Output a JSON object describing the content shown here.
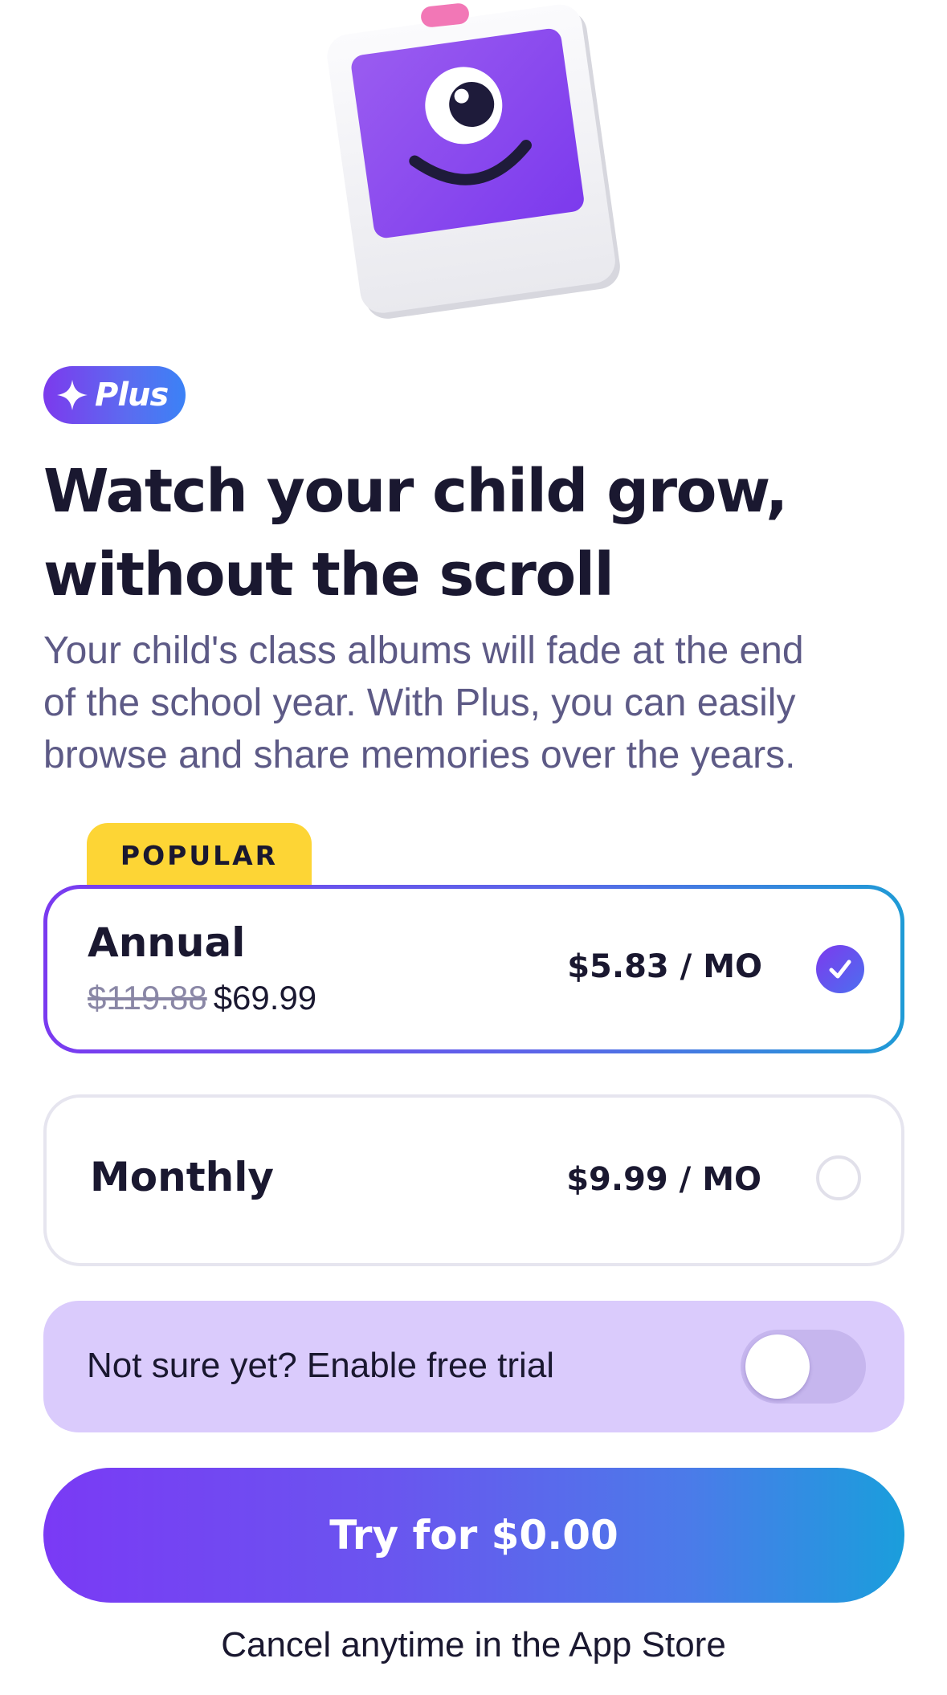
{
  "badge": {
    "label": "Plus",
    "icon": "sparkle-icon"
  },
  "headline": {
    "line1": "Watch your child grow,",
    "line2": "without the scroll"
  },
  "subtext": {
    "line1": "Your child's class albums will fade at the end",
    "line2": "of the school year. With Plus, you can easily",
    "line3": "browse and share memories over the years."
  },
  "plans": {
    "popular_tag": "POPULAR",
    "annual": {
      "name": "Annual",
      "original_price": "$119.88",
      "price": "$69.99",
      "per_month": "$5.83 / MO",
      "selected": true
    },
    "monthly": {
      "name": "Monthly",
      "per_month": "$9.99 / MO",
      "selected": false
    }
  },
  "trial": {
    "label": "Not sure yet? Enable free trial",
    "enabled": false
  },
  "cta": {
    "label": "Try for $0.00"
  },
  "footer": {
    "note": "Cancel anytime in the App Store"
  },
  "colors": {
    "brand_purple": "#7c3aed",
    "accent_blue": "#1a9edc",
    "popular_yellow": "#fdd535",
    "trial_bg": "#dacbfc",
    "text_dark": "#1a1830",
    "text_muted": "#5d5a86"
  }
}
